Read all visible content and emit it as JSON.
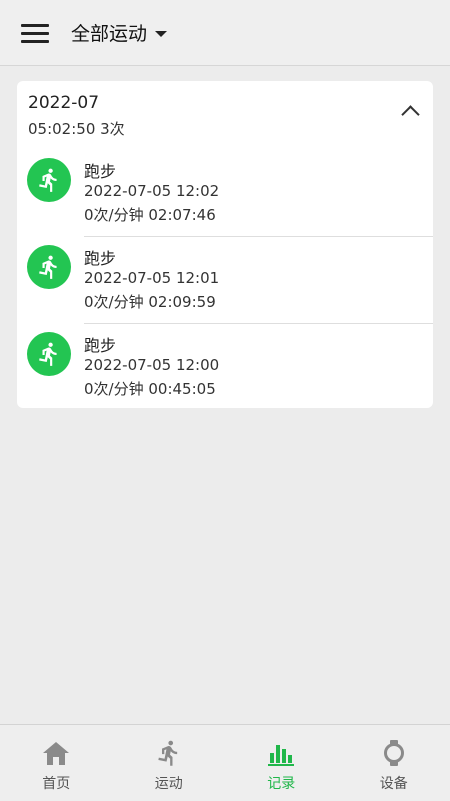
{
  "header": {
    "menu_icon": "menu-icon",
    "title": "全部运动",
    "dropdown_icon": "dropdown-caret-icon"
  },
  "record_group": {
    "month": "2022-07",
    "summary": "05:02:50 3次",
    "collapse_icon": "chevron-up-icon",
    "entries": [
      {
        "icon": "running-person-icon",
        "activity": "跑步",
        "datetime": "2022-07-05 12:02",
        "stats": "0次/分钟 02:07:46"
      },
      {
        "icon": "running-person-icon",
        "activity": "跑步",
        "datetime": "2022-07-05 12:01",
        "stats": "0次/分钟 02:09:59"
      },
      {
        "icon": "running-person-icon",
        "activity": "跑步",
        "datetime": "2022-07-05 12:00",
        "stats": "0次/分钟 00:45:05"
      }
    ]
  },
  "bottom_nav": {
    "items": [
      {
        "label": "首页",
        "icon": "home-icon",
        "active": false
      },
      {
        "label": "运动",
        "icon": "running-person-icon",
        "active": false
      },
      {
        "label": "记录",
        "icon": "bar-chart-icon",
        "active": true
      },
      {
        "label": "设备",
        "icon": "watch-icon",
        "active": false
      }
    ]
  },
  "colors": {
    "accent": "#20b74a",
    "activity_badge": "#23c552",
    "background": "#ececec",
    "inactive_icon": "#8a8a8a"
  }
}
